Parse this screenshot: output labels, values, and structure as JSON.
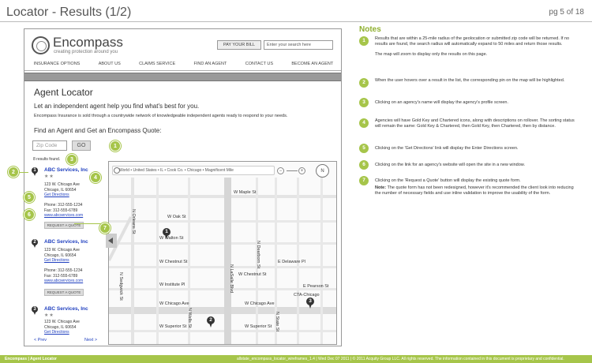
{
  "header": {
    "title": "Locator - Results (1/2)",
    "page": "pg 5 of 18"
  },
  "site": {
    "logo_name": "Encompass",
    "logo_tagline": "creating protection around you",
    "pay_bill": "PAY YOUR BILL",
    "search_placeholder": "Enter your search here",
    "nav": [
      "INSURANCE OPTIONS",
      "ABOUT US",
      "CLAIMS SERVICE",
      "FIND AN AGENT",
      "CONTACT US",
      "BECOME AN AGENT"
    ]
  },
  "content": {
    "heading": "Agent Locator",
    "subheading": "Let an independent agent help you find what's best for you.",
    "description": "Encompass Insurance is sold through a countrywide network of knowledgeable independent agents ready to respond to your needs.",
    "find_heading": "Find an Agent and Get an Encompass Quote:",
    "zip_placeholder": "Zip Code",
    "go_label": "GO",
    "results_found": "8 results found.",
    "prev": "< Prev",
    "next": "Next >"
  },
  "results": [
    {
      "pin": "1",
      "name": "ABC Services, Inc",
      "stars": "★★",
      "address1": "123 W. Chicago Ave",
      "address2": "Chicago, IL   60654",
      "directions": "Get Directions",
      "phone": "Phone: 312-555-1234",
      "fax": "Fax: 312-555-6789",
      "website": "www.abcservices.com",
      "quote": "REQUEST A QUOTE"
    },
    {
      "pin": "2",
      "name": "ABC Services, Inc",
      "stars": "",
      "address1": "123 W. Chicago Ave",
      "address2": "Chicago, IL   60654",
      "directions": "Get Directions",
      "phone": "Phone: 312-555-1234",
      "fax": "Fax: 312-555-6789",
      "website": "www.abcservices.com",
      "quote": "REQUEST A QUOTE"
    },
    {
      "pin": "3",
      "name": "ABC Services, Inc",
      "stars": "★★",
      "address1": "123 W. Chicago Ave",
      "address2": "Chicago, IL   60654",
      "directions": "Get Directions",
      "phone": "",
      "fax": "",
      "website": "",
      "quote": ""
    }
  ],
  "map": {
    "breadcrumb": "World • United States • IL • Cook Co. • Chicago • Magnificent Mile",
    "zoom_out": "−",
    "zoom_in": "+",
    "compass": "N",
    "streets": {
      "maple": "W Maple St",
      "oak": "W Oak St",
      "walton": "W Walton St",
      "delaware": "E Delaware Pl",
      "chestnut1": "W Chestnut St",
      "chestnut2": "W Chestnut St",
      "institute": "W Institute Pl",
      "pearson": "E Pearson St",
      "chicago1": "W Chicago Ave",
      "chicago2": "W Chicago Ave",
      "superior1": "W Superior St",
      "superior2": "W Superior St",
      "orleans": "N Orleans St",
      "sedgwick": "N Sedgwick St",
      "wells": "N Wells St",
      "lasalle": "N LaSalle Blvd",
      "dearborn": "N Dearborn St",
      "state": "N State St",
      "cta": "CTA-Chicago"
    },
    "pins": [
      "1",
      "2",
      "3"
    ]
  },
  "callouts": [
    "1",
    "2",
    "3",
    "4",
    "5",
    "6",
    "7"
  ],
  "notes": {
    "title": "Notes",
    "items": [
      {
        "num": "1",
        "text": "Results that are within a 25-mile radius of the geolocation or submitted zip code will be returned. If no results are found, the search radius will automatically expand to 50 miles and return those results.",
        "extra": "The map will zoom to display only the results on this page."
      },
      {
        "num": "2",
        "text": "When the user hovers over a result in the list, the corresponding pin on the map will be highlighted."
      },
      {
        "num": "3",
        "text": "Clicking on an agency's name will display the agency's profile screen."
      },
      {
        "num": "4",
        "text": "Agencies will have Gold Key and Chartered icons, along with descriptions on rollover. The sorting status will remain the same: Gold Key & Chartered, then Gold Key, then Chartered, then by distance."
      },
      {
        "num": "5",
        "text": "Clicking on the 'Get Directions' link will display the Enter Directions screen."
      },
      {
        "num": "6",
        "text": "Clicking on the link for an agency's website will open the site in a new window."
      },
      {
        "num": "7",
        "text": "Clicking on the 'Request a Quote' button will display the existing quote form.",
        "note_label": "Note:",
        "note_text": "The quote form has not been redesigned, however it's recommended the client look into reducing the number of necessary fields and use inline validation to improve the usability of the form."
      }
    ]
  },
  "footer": {
    "left": "Encompass | Agent Locator",
    "right": "allstate_encompass_locator_wireframes_1.4  |  Wed Dec 07 2011  |  © 2011 Acquity Group LLC. All rights reserved. The information contained in this document is proprietary and confidential."
  },
  "colors": {
    "accent": "#a6c54a",
    "link": "#1f3fbf"
  }
}
